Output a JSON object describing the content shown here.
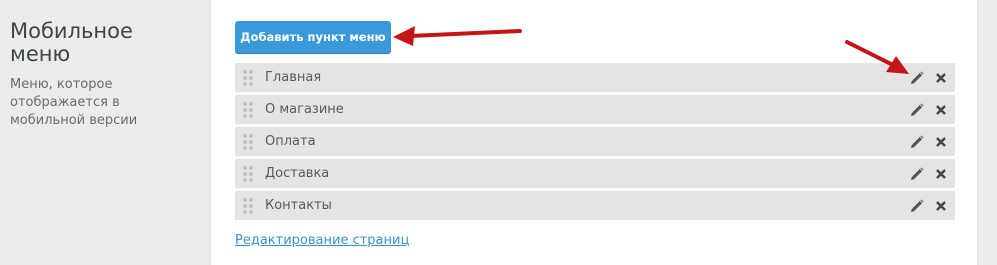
{
  "section": {
    "title": "Мобильное меню",
    "description": "Меню, которое отображается в мобильной версии"
  },
  "toolbar": {
    "add_label": "Добавить пункт меню"
  },
  "menu_items": [
    {
      "label": "Главная"
    },
    {
      "label": "О магазине"
    },
    {
      "label": "Оплата"
    },
    {
      "label": "Доставка"
    },
    {
      "label": "Контакты"
    }
  ],
  "footer": {
    "edit_pages_link": "Редактирование страниц"
  },
  "colors": {
    "accent": "#3a9ad9",
    "annotation_arrow": "#c41414",
    "row_bg": "#e4e4e4",
    "link": "#3a8fd0"
  },
  "icons": {
    "drag": "drag-handle-icon",
    "edit": "pencil-icon",
    "delete": "close-icon"
  }
}
